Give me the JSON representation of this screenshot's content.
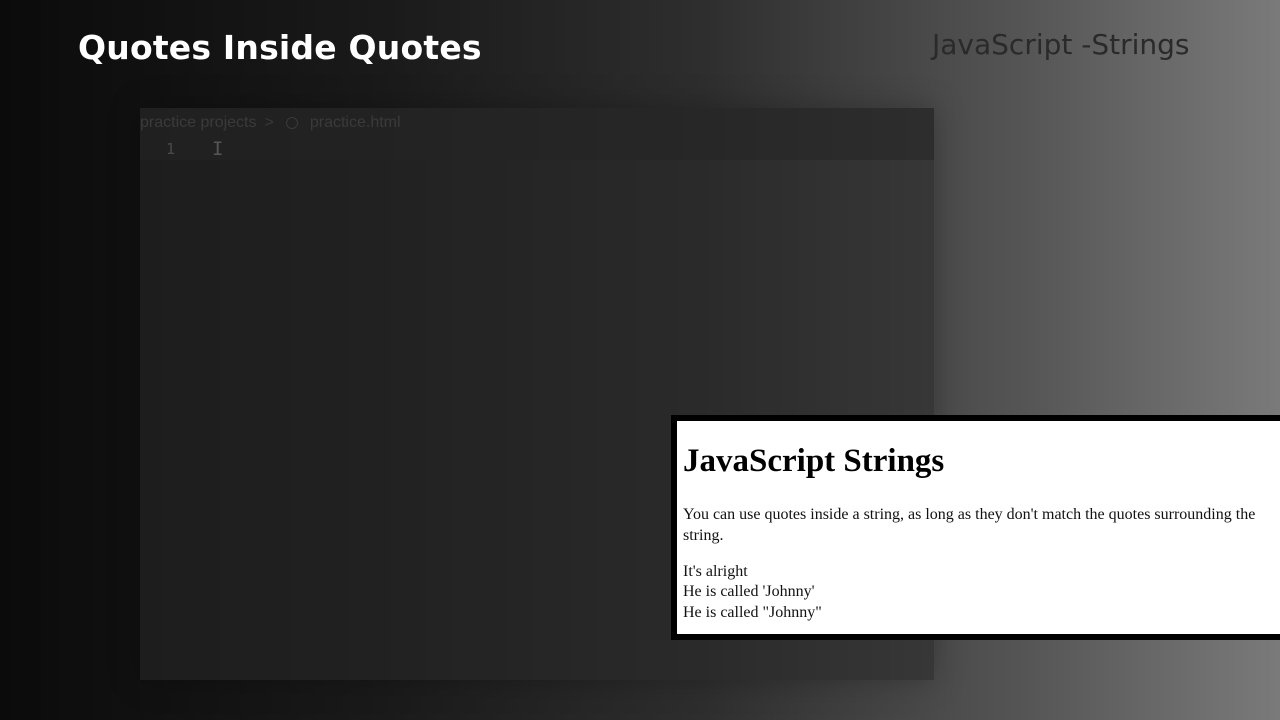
{
  "slide": {
    "title": "Quotes Inside Quotes",
    "topic": "JavaScript -Strings"
  },
  "editor": {
    "breadcrumb": {
      "folder": "practice projects",
      "separator": ">",
      "file": "practice.html",
      "file_icon": "html-file-icon"
    },
    "line_number": "1",
    "cursor_glyph": "I"
  },
  "output": {
    "heading": "JavaScript Strings",
    "paragraph": "You can use quotes inside a string, as long as they don't match the quotes surrounding the string.",
    "lines": [
      "It's alright",
      "He is called 'Johnny'",
      "He is called \"Johnny\""
    ]
  }
}
